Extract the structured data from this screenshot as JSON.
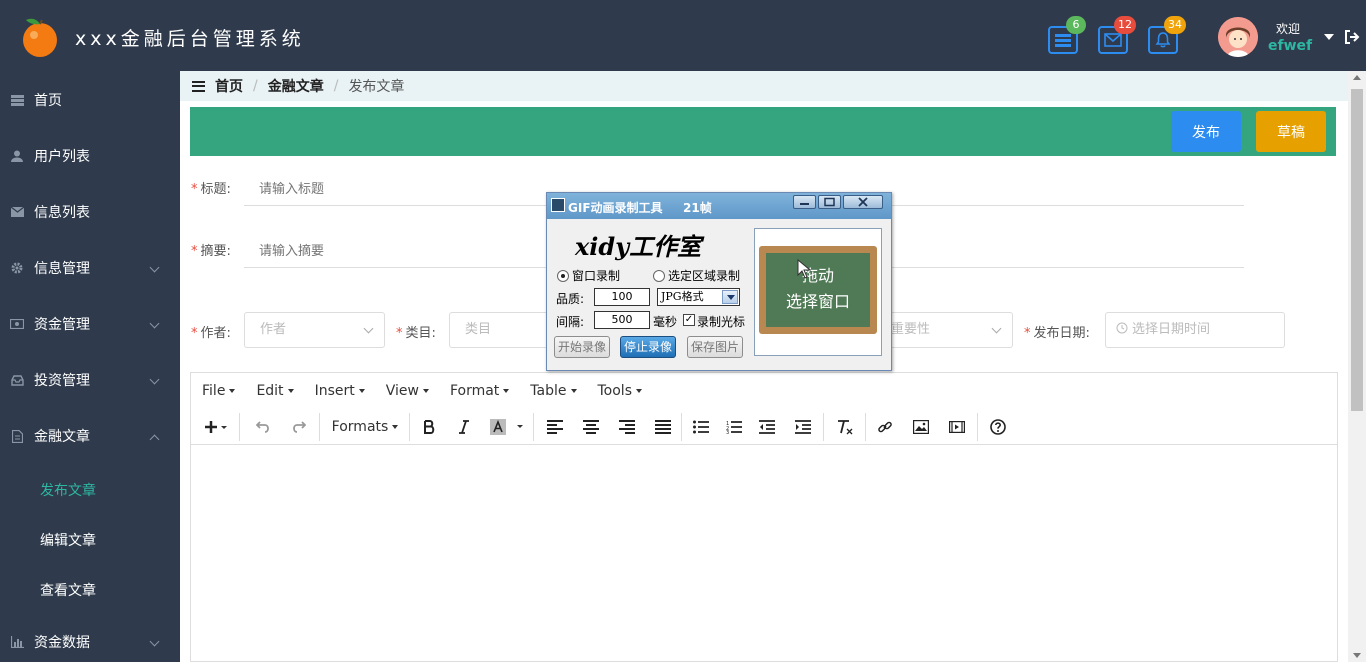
{
  "header": {
    "app_title": "xxx金融后台管理系统",
    "badges": {
      "tasks": "6",
      "messages": "12",
      "notifications": "34"
    },
    "welcome": "欢迎",
    "username": "efwef"
  },
  "colors": {
    "sidebar_bg": "#2f3b4c",
    "accent": "#2db7a2",
    "action_bar": "#35a57f",
    "publish": "#2d8cf0",
    "draft": "#e6a100"
  },
  "sidebar": {
    "items": [
      {
        "label": "首页",
        "icon": "list-icon"
      },
      {
        "label": "用户列表",
        "icon": "user-icon"
      },
      {
        "label": "信息列表",
        "icon": "envelope-icon"
      },
      {
        "label": "信息管理",
        "icon": "gear-icon"
      },
      {
        "label": "资金管理",
        "icon": "money-icon"
      },
      {
        "label": "投资管理",
        "icon": "inbox-icon"
      },
      {
        "label": "金融文章",
        "icon": "document-icon"
      },
      {
        "label": "资金数据",
        "icon": "bar-chart-icon"
      }
    ],
    "sub_items": [
      {
        "label": "发布文章"
      },
      {
        "label": "编辑文章"
      },
      {
        "label": "查看文章"
      }
    ]
  },
  "breadcrumb": {
    "home": "首页",
    "section": "金融文章",
    "current": "发布文章"
  },
  "actions": {
    "publish": "发布",
    "draft": "草稿"
  },
  "form": {
    "title_label": "标题:",
    "title_placeholder": "请输入标题",
    "summary_label": "摘要:",
    "summary_placeholder": "请输入摘要",
    "author_label": "作者:",
    "author_placeholder": "作者",
    "category_label": "类目:",
    "category_placeholder": "类目",
    "importance_placeholder": "重要性",
    "date_label": "发布日期:",
    "date_placeholder": "选择日期时间"
  },
  "editor": {
    "menus": [
      "File",
      "Edit",
      "Insert",
      "View",
      "Format",
      "Table",
      "Tools"
    ],
    "formats_label": "Formats"
  },
  "gif_tool": {
    "title": "GIF动画录制工具",
    "frames": "21帧",
    "logo": "xidy工作室",
    "mode_window": "窗口录制",
    "mode_region": "选定区域录制",
    "quality_label": "品质:",
    "quality_value": "100",
    "format_value": "JPG格式",
    "interval_label": "间隔:",
    "interval_value": "500",
    "interval_unit": "毫秒",
    "record_cursor": "录制光标",
    "btn_start": "开始录像",
    "btn_stop": "停止录像",
    "btn_save": "保存图片",
    "preview_line1": "拖动",
    "preview_line2": "选择窗口"
  }
}
